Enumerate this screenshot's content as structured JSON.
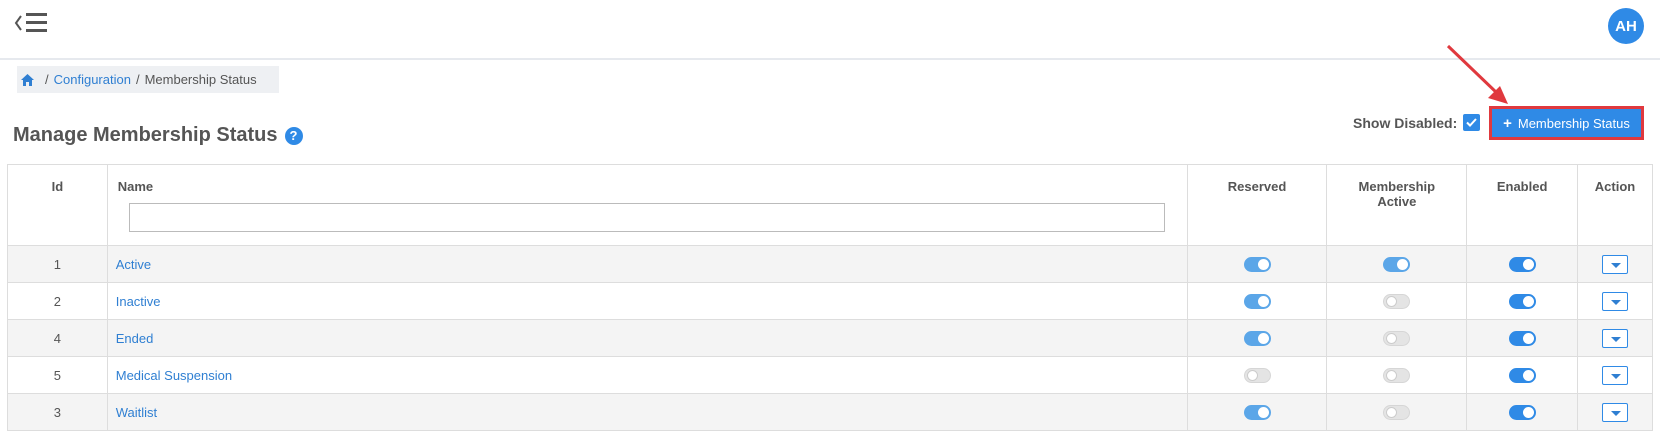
{
  "header": {
    "avatar_initials": "AH"
  },
  "breadcrumb": {
    "home_icon": "home-icon",
    "separator": "/",
    "config_label": "Configuration",
    "current_label": "Membership Status"
  },
  "page": {
    "title": "Manage Membership Status"
  },
  "toolbar": {
    "show_disabled_label": "Show Disabled:",
    "show_disabled_checked": true,
    "add_button_label": "Membership Status"
  },
  "table": {
    "columns": {
      "id": "Id",
      "name": "Name",
      "reserved": "Reserved",
      "membership_active_1": "Membership",
      "membership_active_2": "Active",
      "enabled": "Enabled",
      "action": "Action"
    },
    "name_filter_value": "",
    "rows": [
      {
        "id": "1",
        "name": "Active",
        "reserved": true,
        "membership_active": true,
        "enabled": true
      },
      {
        "id": "2",
        "name": "Inactive",
        "reserved": true,
        "membership_active": false,
        "enabled": true
      },
      {
        "id": "4",
        "name": "Ended",
        "reserved": true,
        "membership_active": false,
        "enabled": true
      },
      {
        "id": "5",
        "name": "Medical Suspension",
        "reserved": false,
        "membership_active": false,
        "enabled": true
      },
      {
        "id": "3",
        "name": "Waitlist",
        "reserved": true,
        "membership_active": false,
        "enabled": true
      }
    ]
  },
  "colors": {
    "primary": "#2f8ae6",
    "link": "#2f7fd2",
    "highlight": "#e0393e"
  }
}
